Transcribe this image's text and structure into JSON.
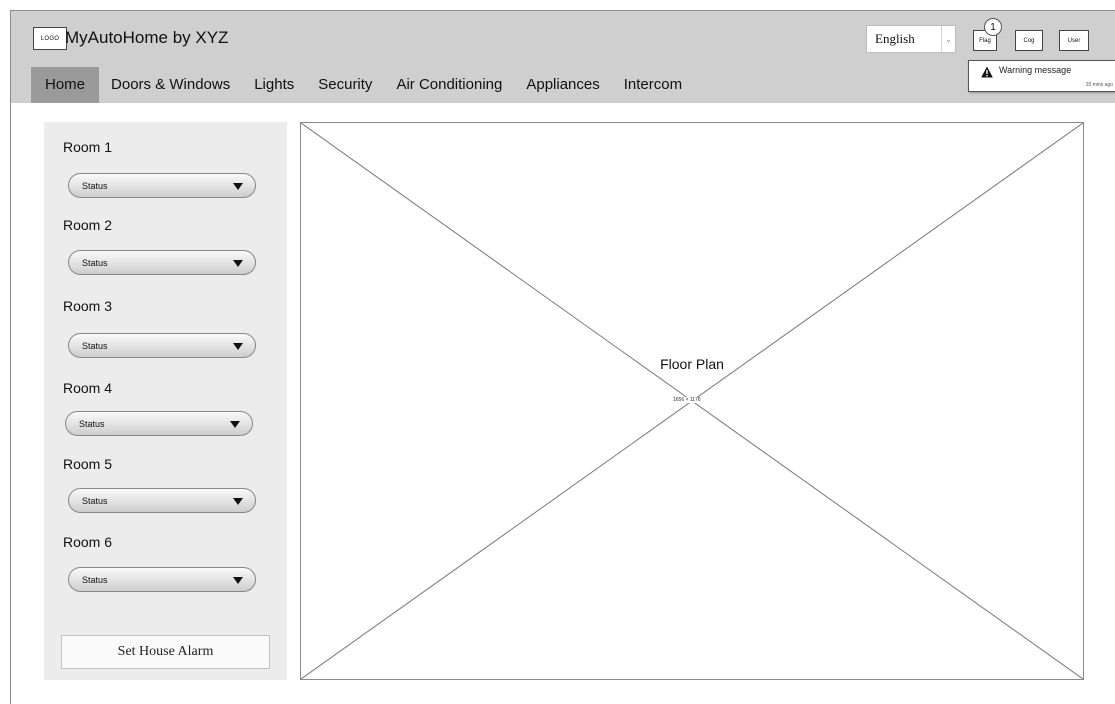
{
  "header": {
    "logo_text": "LOGO",
    "app_title": "MyAutoHome by XYZ",
    "language": {
      "selected": "English"
    },
    "buttons": {
      "flag": "Flag",
      "cog": "Cog",
      "user": "User"
    },
    "flag_count": "1",
    "notification": {
      "message": "Warning message",
      "time": "20 mins ago",
      "icon": "warning-icon"
    }
  },
  "nav": {
    "items": [
      "Home",
      "Doors & Windows",
      "Lights",
      "Security",
      "Air Conditioning",
      "Appliances",
      "Intercom"
    ],
    "active": "Home"
  },
  "sidebar": {
    "rooms": [
      {
        "name": "Room 1",
        "status": "Status"
      },
      {
        "name": "Room 2",
        "status": "Status"
      },
      {
        "name": "Room 3",
        "status": "Status"
      },
      {
        "name": "Room 4",
        "status": "Status"
      },
      {
        "name": "Room 5",
        "status": "Status"
      },
      {
        "name": "Room 6",
        "status": "Status"
      }
    ],
    "alarm_button": "Set House Alarm"
  },
  "floor_plan": {
    "title": "Floor Plan",
    "size_label": "1656 × 1176"
  },
  "colors": {
    "header_bg": "#cfcfcf",
    "nav_active_bg": "#9a9a9a",
    "sidebar_bg": "#ececec"
  }
}
